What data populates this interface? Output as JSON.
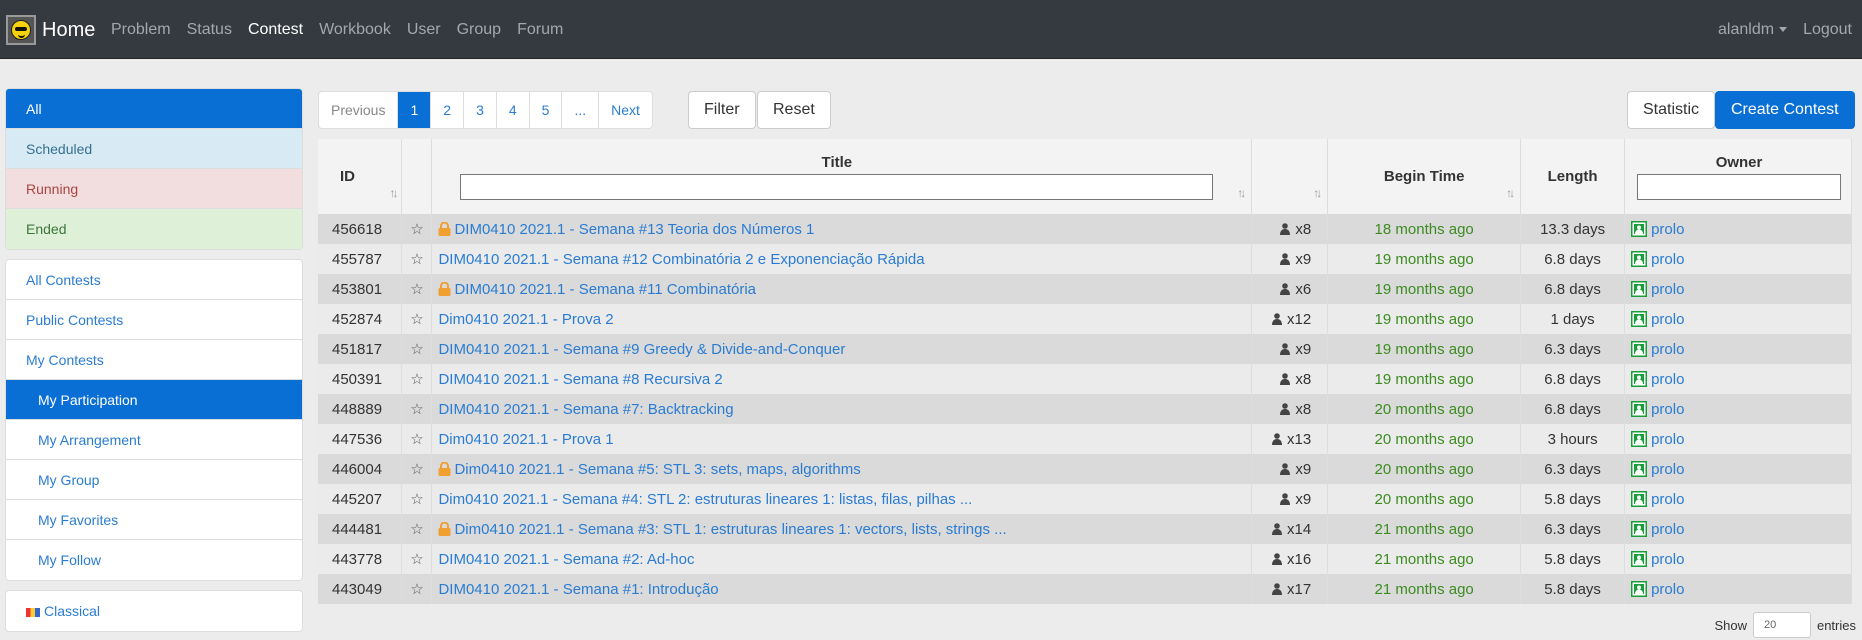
{
  "nav": {
    "brand": "Home",
    "links": [
      "Problem",
      "Status",
      "Contest",
      "Workbook",
      "User",
      "Group",
      "Forum"
    ],
    "user": "alanldm",
    "logout": "Logout"
  },
  "sidebar": {
    "status": [
      "All",
      "Scheduled",
      "Running",
      "Ended"
    ],
    "contests": [
      "All Contests",
      "Public Contests",
      "My Contests",
      "My Participation",
      "My Arrangement",
      "My Group",
      "My Favorites",
      "My Follow"
    ],
    "type": "Classical"
  },
  "pager": {
    "prev": "Previous",
    "pages": [
      "1",
      "2",
      "3",
      "4",
      "5",
      "..."
    ],
    "next": "Next"
  },
  "toolbar": {
    "filter": "Filter",
    "reset": "Reset",
    "statistic": "Statistic",
    "create": "Create Contest"
  },
  "table": {
    "headers": {
      "id": "ID",
      "title": "Title",
      "begin": "Begin Time",
      "length": "Length",
      "owner": "Owner"
    },
    "rows": [
      {
        "id": "456618",
        "locked": true,
        "title": "DIM0410 2021.1 - Semana #13 Teoria dos Números 1",
        "participants": "x8",
        "begin": "18 months ago",
        "length": "13.3 days",
        "owner": "prolo"
      },
      {
        "id": "455787",
        "locked": false,
        "title": "DIM0410 2021.1 - Semana #12 Combinatória 2 e Exponenciação Rápida",
        "participants": "x9",
        "begin": "19 months ago",
        "length": "6.8 days",
        "owner": "prolo"
      },
      {
        "id": "453801",
        "locked": true,
        "title": "DIM0410 2021.1 - Semana #11 Combinatória",
        "participants": "x6",
        "begin": "19 months ago",
        "length": "6.8 days",
        "owner": "prolo"
      },
      {
        "id": "452874",
        "locked": false,
        "title": "Dim0410 2021.1 - Prova 2",
        "participants": "x12",
        "begin": "19 months ago",
        "length": "1 days",
        "owner": "prolo"
      },
      {
        "id": "451817",
        "locked": false,
        "title": "DIM0410 2021.1 - Semana #9 Greedy & Divide-and-Conquer",
        "participants": "x9",
        "begin": "19 months ago",
        "length": "6.3 days",
        "owner": "prolo"
      },
      {
        "id": "450391",
        "locked": false,
        "title": "DIM0410 2021.1 - Semana #8 Recursiva 2",
        "participants": "x8",
        "begin": "19 months ago",
        "length": "6.8 days",
        "owner": "prolo"
      },
      {
        "id": "448889",
        "locked": false,
        "title": "DIM0410 2021.1 - Semana #7: Backtracking",
        "participants": "x8",
        "begin": "20 months ago",
        "length": "6.8 days",
        "owner": "prolo"
      },
      {
        "id": "447536",
        "locked": false,
        "title": "Dim0410 2021.1 - Prova 1",
        "participants": "x13",
        "begin": "20 months ago",
        "length": "3 hours",
        "owner": "prolo"
      },
      {
        "id": "446004",
        "locked": true,
        "title": "Dim0410 2021.1 - Semana #5: STL 3: sets, maps, algorithms",
        "participants": "x9",
        "begin": "20 months ago",
        "length": "6.3 days",
        "owner": "prolo"
      },
      {
        "id": "445207",
        "locked": false,
        "title": "Dim0410 2021.1 - Semana #4: STL 2: estruturas lineares 1: listas, filas, pilhas ...",
        "participants": "x9",
        "begin": "20 months ago",
        "length": "5.8 days",
        "owner": "prolo"
      },
      {
        "id": "444481",
        "locked": true,
        "title": "Dim0410 2021.1 - Semana #3: STL 1: estruturas lineares 1: vectors, lists, strings ...",
        "participants": "x14",
        "begin": "21 months ago",
        "length": "6.3 days",
        "owner": "prolo"
      },
      {
        "id": "443778",
        "locked": false,
        "title": "DIM0410 2021.1 - Semana #2: Ad-hoc",
        "participants": "x16",
        "begin": "21 months ago",
        "length": "5.8 days",
        "owner": "prolo"
      },
      {
        "id": "443049",
        "locked": false,
        "title": "DIM0410 2021.1 - Semana #1: Introdução",
        "participants": "x17",
        "begin": "21 months ago",
        "length": "5.8 days",
        "owner": "prolo"
      }
    ]
  },
  "entries": {
    "show": "Show",
    "value": "20",
    "label": "entries"
  },
  "colors": {
    "primary": "#0a6fd4",
    "link": "#2a7cd3",
    "begin_time": "#3c8c21",
    "lock": "#f0a030",
    "navbar": "#343a3f"
  },
  "icons": {
    "star": "☆",
    "sort": "↑↓"
  }
}
